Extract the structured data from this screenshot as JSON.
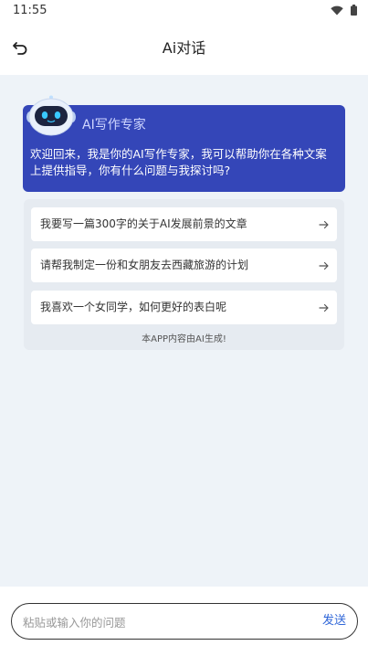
{
  "status_bar": {
    "time": "11:55",
    "icons": [
      "wifi-icon",
      "battery-icon"
    ]
  },
  "header": {
    "back_icon": "back-arrow-icon",
    "title": "Ai对话"
  },
  "intro": {
    "avatar_icon": "robot-icon",
    "title": "AI写作专家",
    "message": "欢迎回来，我是你的AI写作专家，我可以帮助你在各种文案上提供指导，你有什么问题与我探讨吗?"
  },
  "suggestions": [
    {
      "text": "我要写一篇300字的关于AI发展前景的文章"
    },
    {
      "text": "请帮我制定一份和女朋友去西藏旅游的计划"
    },
    {
      "text": "我喜欢一个女同学，如何更好的表白呢"
    }
  ],
  "disclaimer": "本APP内容由AI生成!",
  "input": {
    "placeholder": "粘贴或输入你的问题",
    "value": "",
    "send_label": "发送"
  },
  "colors": {
    "accent": "#3446b8",
    "background": "#eef3f8",
    "send": "#2f66d8"
  }
}
